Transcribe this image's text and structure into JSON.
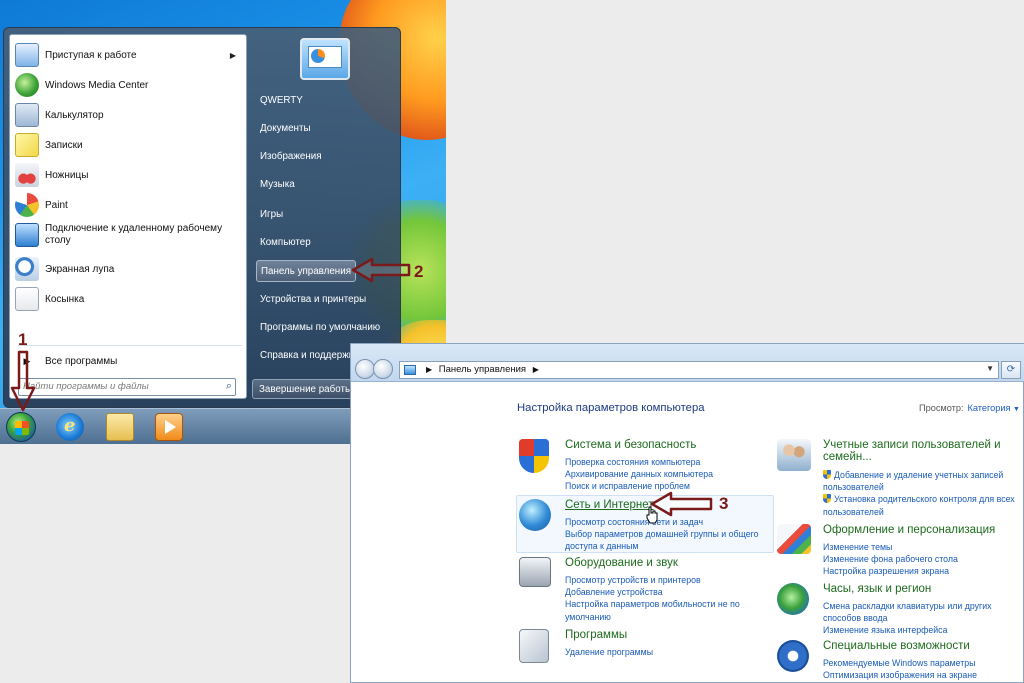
{
  "start_menu": {
    "pinned": [
      {
        "label": "Приступая к работе",
        "icon": "getting-started-icon",
        "has_arrow": true
      },
      {
        "label": "Windows Media Center",
        "icon": "media-center-icon"
      },
      {
        "label": "Калькулятор",
        "icon": "calculator-icon"
      },
      {
        "label": "Записки",
        "icon": "sticky-notes-icon"
      },
      {
        "label": "Ножницы",
        "icon": "scissors-icon"
      },
      {
        "label": "Paint",
        "icon": "paint-icon"
      },
      {
        "label": "Подключение к удаленному рабочему столу",
        "icon": "remote-desktop-icon"
      },
      {
        "label": "Экранная лупа",
        "icon": "magnifier-icon"
      },
      {
        "label": "Косынка",
        "icon": "solitaire-icon"
      }
    ],
    "all_programs": "Все программы",
    "search_placeholder": "Найти программы и файлы",
    "right": {
      "user": "QWERTY",
      "items": [
        "Документы",
        "Изображения",
        "Музыка",
        "Игры",
        "Компьютер",
        "Панель управления",
        "Устройства и принтеры",
        "Программы по умолчанию",
        "Справка и поддержка"
      ],
      "active_index": 5,
      "shutdown": "Завершение работы"
    }
  },
  "annotations": {
    "step1": "1",
    "step2": "2",
    "step3": "3",
    "arrow_color": "#7a1a1a"
  },
  "control_panel": {
    "address": {
      "path_item": "Панель управления"
    },
    "heading": "Настройка параметров компьютера",
    "view_by_label": "Просмотр:",
    "view_by_value": "Категория",
    "categories_left": [
      {
        "title": "Система и безопасность",
        "icon": "security-shield-icon",
        "links": [
          "Проверка состояния компьютера",
          "Архивирование данных компьютера",
          "Поиск и исправление проблем"
        ]
      },
      {
        "title": "Сеть и Интернет",
        "icon": "network-globe-icon",
        "links": [
          "Просмотр состояния сети и задач",
          "Выбор параметров домашней группы и общего",
          "доступа к данным"
        ]
      },
      {
        "title": "Оборудование и звук",
        "icon": "printer-speaker-icon",
        "links": [
          "Просмотр устройств и принтеров",
          "Добавление устройства",
          "Настройка параметров мобильности не по",
          "умолчанию"
        ]
      },
      {
        "title": "Программы",
        "icon": "programs-icon",
        "links": [
          "Удаление программы"
        ]
      }
    ],
    "categories_right": [
      {
        "title": "Учетные записи пользователей и",
        "title2": "семейн...",
        "icon": "user-accounts-icon",
        "links": [
          "Добавление и удаление учетных записей",
          "пользователей",
          "Установка родительского контроля для всех",
          "пользователей"
        ],
        "shield_links": [
          0,
          2
        ]
      },
      {
        "title": "Оформление и персонализация",
        "icon": "personalization-icon",
        "links": [
          "Изменение темы",
          "Изменение фона рабочего стола",
          "Настройка разрешения экрана"
        ]
      },
      {
        "title": "Часы, язык и регион",
        "icon": "clock-globe-icon",
        "links": [
          "Смена раскладки клавиатуры или других",
          "способов ввода",
          "Изменение языка интерфейса"
        ]
      },
      {
        "title": "Специальные возможности",
        "icon": "accessibility-icon",
        "links": [
          "Рекомендуемые Windows параметры",
          "Оптимизация изображения на экране"
        ]
      }
    ]
  }
}
